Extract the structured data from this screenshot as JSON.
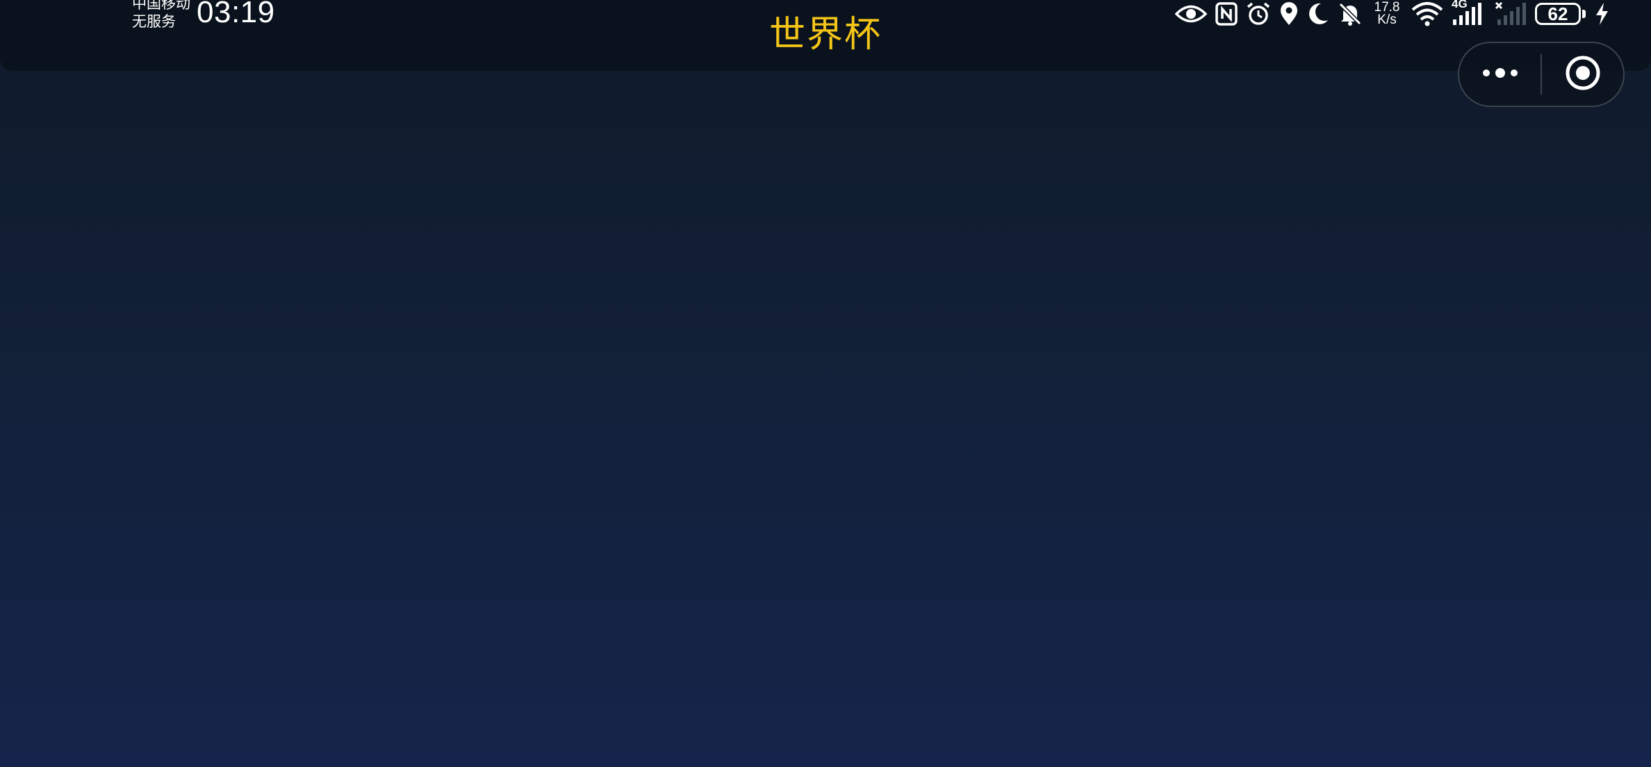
{
  "status_bar": {
    "carrier_line1": "中国移动",
    "carrier_line2": "无服务",
    "time": "03:19",
    "net_speed_value": "17.8",
    "net_speed_unit": "K/s",
    "network_type": "4G",
    "battery_level": "62",
    "icons": [
      "eye-icon",
      "nfc-icon",
      "alarm-icon",
      "location-icon",
      "moon-icon",
      "bell-muted-icon",
      "wifi-icon",
      "signal-icon",
      "signal-no-service-icon",
      "battery-icon",
      "charging-icon"
    ]
  },
  "header": {
    "title": "世界杯",
    "title_color": "#f5c518"
  },
  "capsule": {
    "more_icon": "more-dots-icon",
    "close_icon": "target-close-icon"
  },
  "colors": {
    "background_top": "#0f1b29",
    "background_bottom": "#15244a",
    "status_bar_bg": "#0a131d"
  }
}
